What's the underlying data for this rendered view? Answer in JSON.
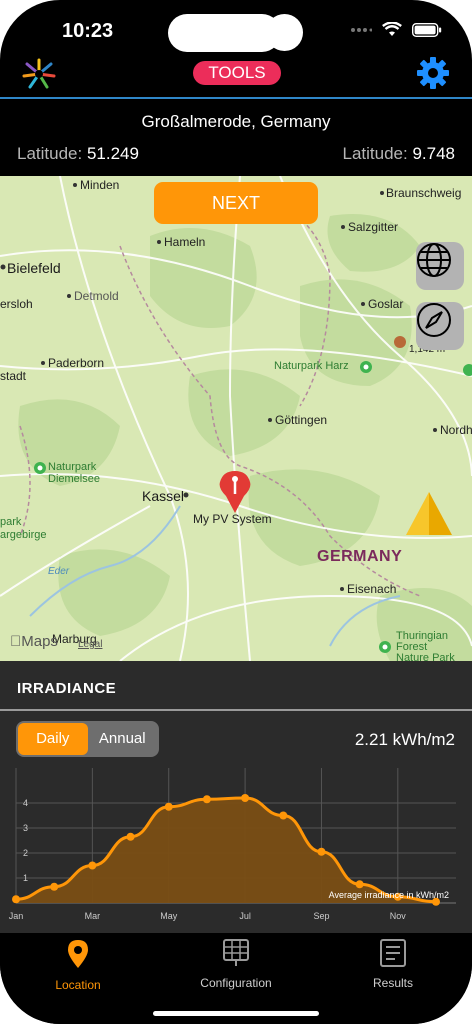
{
  "status": {
    "time": "10:23"
  },
  "nav": {
    "tools_label": "TOOLS"
  },
  "location": {
    "place": "Großalmerode, Germany",
    "lat_label": "Latitude:",
    "lat_value": "51.249",
    "lon_label": "Latitude:",
    "lon_value": "9.748"
  },
  "map": {
    "next_label": "NEXT",
    "pin_label": "My PV System",
    "maps_brand": "Maps",
    "legal": "Legal",
    "places": {
      "minden": "Minden",
      "braunschweig": "Braunschweig",
      "salzgitter": "Salzgitter",
      "hameln": "Hameln",
      "bielefeld": "Bielefeld",
      "detmold": "Detmold",
      "oslo": "ersloh",
      "goslar": "Goslar",
      "paderborn": "Paderborn",
      "stadt": "stadt",
      "naturpark_harz": "Naturpark Harz",
      "brocken": "1,142 m",
      "gottingen": "Göttingen",
      "nordh": "Nordh",
      "naturpark_diemelsee": "Naturpark\nDiemelsee",
      "kassel": "Kassel",
      "park": "park\nargebirge",
      "eder": "Eder",
      "germany": "GERMANY",
      "eisenach": "Eisenach",
      "marburg": "Marburg",
      "thuringian": "Thuringian\nForest\nNature Park"
    }
  },
  "irradiance": {
    "title": "IRRADIANCE",
    "tab_daily": "Daily",
    "tab_annual": "Annual",
    "value": "2.21 kWh/m2"
  },
  "chart_data": {
    "type": "area",
    "title": "",
    "annotation": "Average irradiance in kWh/m2",
    "x": [
      "Jan",
      "Feb",
      "Mar",
      "Apr",
      "May",
      "Jun",
      "Jul",
      "Aug",
      "Sep",
      "Oct",
      "Nov",
      "Dec"
    ],
    "x_tick_labels": [
      "Jan",
      "Mar",
      "May",
      "Jul",
      "Sep",
      "Nov"
    ],
    "y_ticks": [
      1,
      2,
      3,
      4
    ],
    "ylim": [
      0,
      5.4
    ],
    "series": [
      {
        "values": [
          0.15,
          0.65,
          1.5,
          2.65,
          3.85,
          4.15,
          4.2,
          3.5,
          2.05,
          0.75,
          0.25,
          0.05
        ]
      }
    ],
    "colors": {
      "line": "#ff9608",
      "fill": "#7a4e14",
      "grid": "#555555"
    },
    "grid": true
  },
  "tabs": {
    "location": "Location",
    "configuration": "Configuration",
    "results": "Results"
  },
  "colors": {
    "accent": "#ff9608",
    "tools": "#ec2d5a",
    "gear": "#1e8fff",
    "divider": "#2f86c8"
  }
}
